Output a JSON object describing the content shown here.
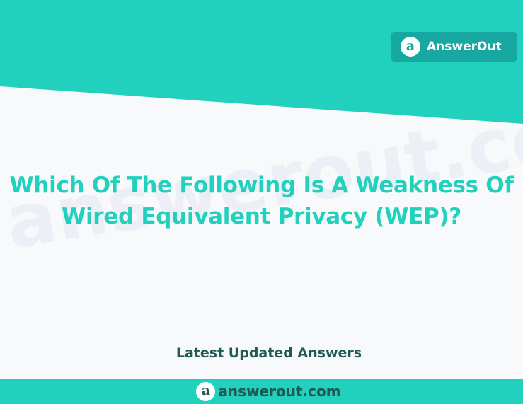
{
  "header": {
    "brand_label": "AnswerOut",
    "logo_letter": "a"
  },
  "main": {
    "question_line1": "Which Of The Following Is A Weakness Of",
    "question_line2": "Wired Equivalent Privacy (WEP)?",
    "watermark": "answerout.com",
    "latest_label": "Latest Updated Answers"
  },
  "footer": {
    "logo_letter": "a",
    "url": "answerout.com"
  },
  "colors": {
    "teal": "#21d0bd",
    "dark_teal": "#17a8a2",
    "dark_green": "#1f5a53",
    "background": "#f8f9fa"
  }
}
